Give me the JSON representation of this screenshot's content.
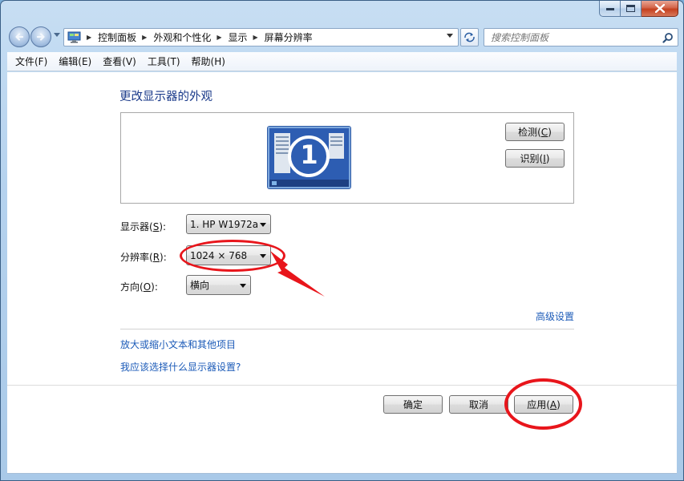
{
  "address_bar": {
    "breadcrumbs": [
      "控制面板",
      "外观和个性化",
      "显示",
      "屏幕分辨率"
    ],
    "icon": "control-panel-icon"
  },
  "search": {
    "placeholder": "搜索控制面板"
  },
  "menu": {
    "items": [
      "文件(F)",
      "编辑(E)",
      "查看(V)",
      "工具(T)",
      "帮助(H)"
    ]
  },
  "main": {
    "title": "更改显示器的外观",
    "monitor_number": "1",
    "detect": {
      "text": "检测(",
      "key": "C",
      "end": ")"
    },
    "identify": {
      "text": "识别(",
      "key": "I",
      "end": ")"
    },
    "display": {
      "label": "显示器(",
      "key": "S",
      "end": "):",
      "value": "1. HP W1972a"
    },
    "resolution": {
      "label": "分辨率(",
      "key": "R",
      "end": "):",
      "value": "1024 × 768"
    },
    "orientation": {
      "label": "方向(",
      "key": "O",
      "end": "):",
      "value": "横向"
    },
    "advanced_link": "高级设置",
    "links": [
      "放大或缩小文本和其他项目",
      "我应该选择什么显示器设置?"
    ]
  },
  "footer": {
    "ok": "确定",
    "cancel": "取消",
    "apply": {
      "text": "应用(",
      "key": "A",
      "end": ")"
    }
  },
  "colors": {
    "link": "#1c5bb8",
    "title": "#1a3a8a",
    "annotation": "#e8151b"
  }
}
